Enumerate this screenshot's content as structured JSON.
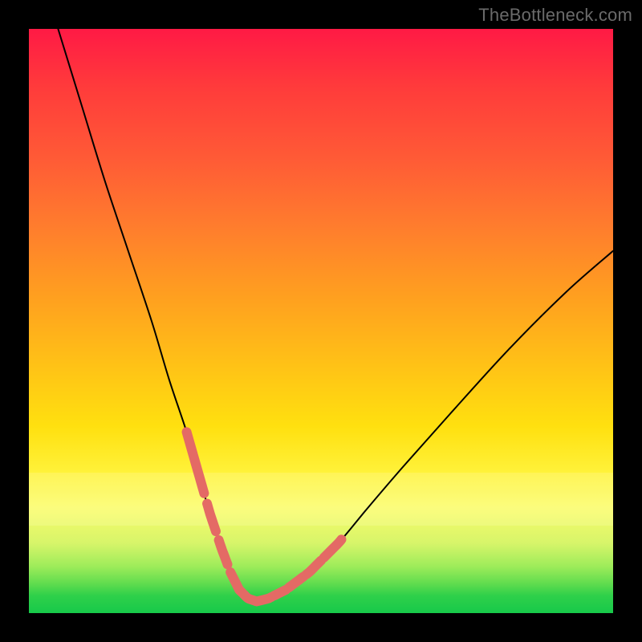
{
  "watermark": "TheBottleneck.com",
  "chart_data": {
    "type": "line",
    "title": "",
    "xlabel": "",
    "ylabel": "",
    "xlim": [
      0,
      100
    ],
    "ylim": [
      0,
      100
    ],
    "grid": false,
    "legend": false,
    "series": [
      {
        "name": "bottleneck-curve",
        "x": [
          5,
          9,
          13,
          17,
          21,
          24,
          27,
          29,
          31,
          33,
          34.5,
          36,
          37.5,
          39,
          41,
          44,
          48,
          53,
          58,
          64,
          72,
          82,
          92,
          100
        ],
        "y": [
          100,
          87,
          74,
          62,
          50,
          40,
          31,
          24,
          17,
          11,
          7,
          4,
          2.5,
          2,
          2.5,
          4,
          7,
          12,
          18,
          25,
          34,
          45,
          55,
          62
        ]
      }
    ],
    "highlight_segments": {
      "description": "Salmon bead segments overlaid on the curve near the valley region",
      "color": "#e46a65",
      "segments": [
        {
          "x_start": 27,
          "x_end": 30
        },
        {
          "x_start": 30.5,
          "x_end": 32
        },
        {
          "x_start": 32.5,
          "x_end": 34
        },
        {
          "x_start": 34.5,
          "x_end": 36.5
        },
        {
          "x_start": 36.8,
          "x_end": 39
        },
        {
          "x_start": 39.3,
          "x_end": 41.5
        },
        {
          "x_start": 42,
          "x_end": 44
        },
        {
          "x_start": 44.5,
          "x_end": 47
        },
        {
          "x_start": 47.5,
          "x_end": 50
        },
        {
          "x_start": 50.5,
          "x_end": 53.5
        }
      ]
    },
    "pale_band": {
      "y_start": 15,
      "y_end": 24,
      "opacity": 0.45
    }
  }
}
